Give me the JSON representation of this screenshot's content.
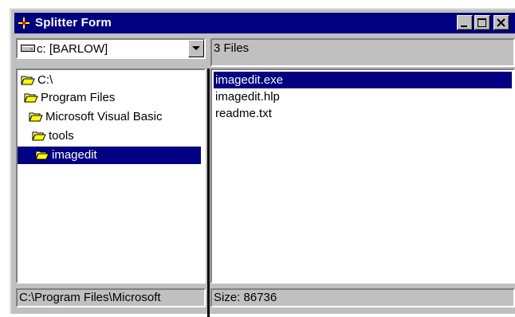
{
  "window": {
    "title": "Splitter Form",
    "icon": "splitter-icon",
    "buttons": [
      "minimize-icon",
      "maximize-icon",
      "close-icon"
    ]
  },
  "drive": {
    "label": "c: [BARLOW]",
    "icon": "drive-icon"
  },
  "files_header": "3 Files",
  "directories": [
    {
      "label": "C:\\",
      "icon": "open-folder-icon",
      "selected": false
    },
    {
      "label": "Program Files",
      "icon": "open-folder-icon",
      "selected": false
    },
    {
      "label": "Microsoft Visual Basic",
      "icon": "open-folder-icon",
      "selected": false
    },
    {
      "label": "tools",
      "icon": "open-folder-icon",
      "selected": false
    },
    {
      "label": "imagedit",
      "icon": "open-folder-icon",
      "selected": true
    }
  ],
  "files": [
    {
      "label": "imagedit.exe",
      "selected": true
    },
    {
      "label": "imagedit.hlp",
      "selected": false
    },
    {
      "label": "readme.txt",
      "selected": false
    }
  ],
  "status": {
    "path": "C:\\Program Files\\Microsoft",
    "size": "Size: 86736"
  },
  "colors": {
    "titlebar": "#000080",
    "face": "#c0c0c0",
    "selection": "#000080"
  }
}
